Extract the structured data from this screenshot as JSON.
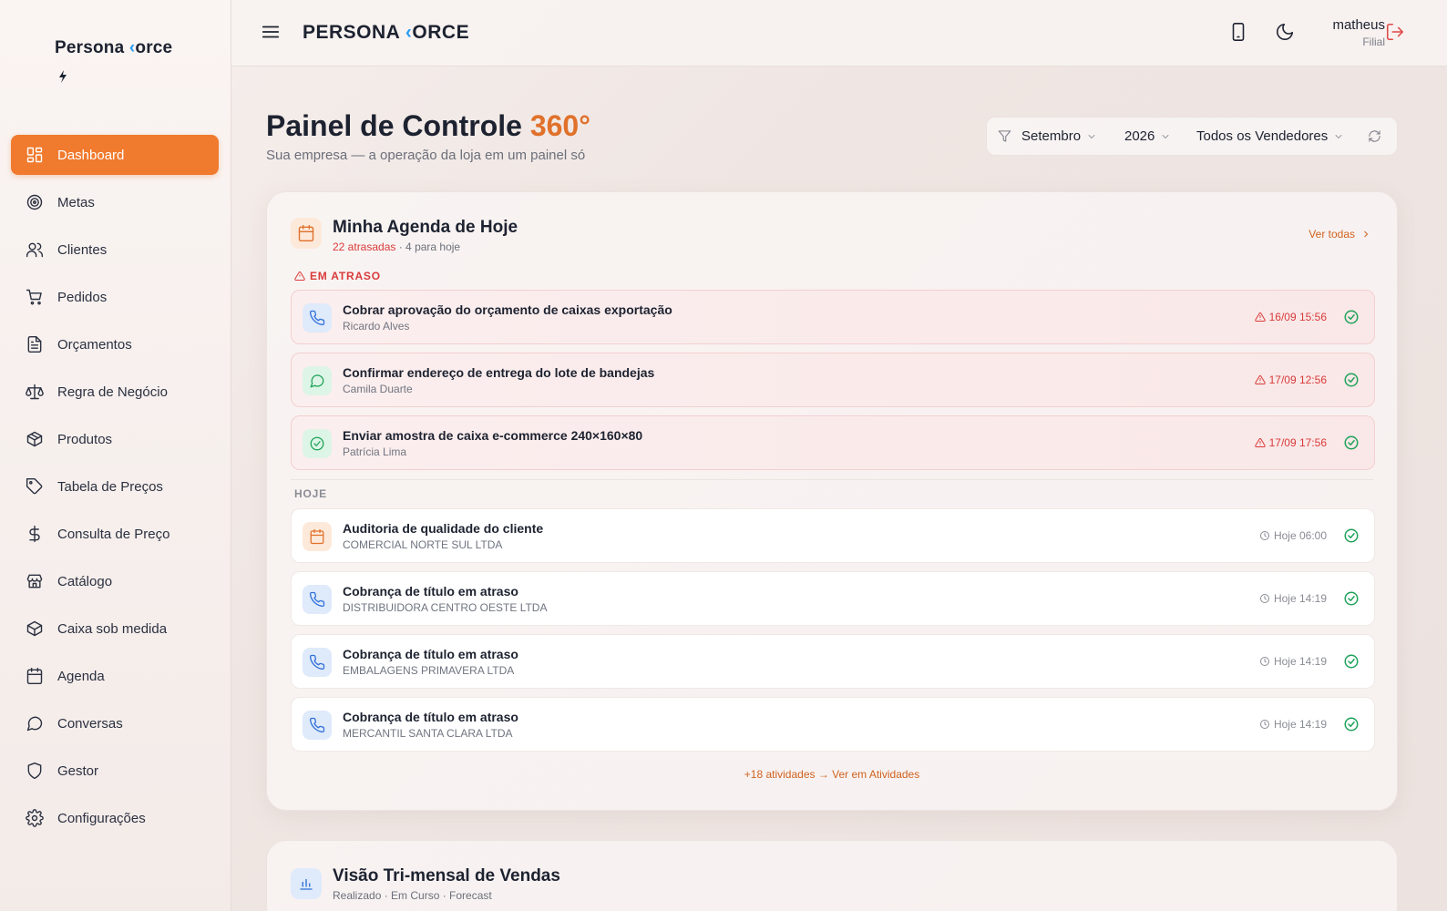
{
  "sidebar": {
    "brand_left": "Persona ",
    "brand_bolt": "⚡",
    "brand_right": "orce",
    "brand_sub": "⚡",
    "items": [
      {
        "label": "Dashboard",
        "icon": "dashboard-icon",
        "active": true
      },
      {
        "label": "Metas",
        "icon": "target-icon"
      },
      {
        "label": "Clientes",
        "icon": "users-icon"
      },
      {
        "label": "Pedidos",
        "icon": "cart-icon"
      },
      {
        "label": "Orçamentos",
        "icon": "document-icon"
      },
      {
        "label": "Regra de Negócio",
        "icon": "scale-icon"
      },
      {
        "label": "Produtos",
        "icon": "package-icon"
      },
      {
        "label": "Tabela de Preços",
        "icon": "tag-icon"
      },
      {
        "label": "Consulta de Preço",
        "icon": "dollar-icon"
      },
      {
        "label": "Catálogo",
        "icon": "store-icon"
      },
      {
        "label": "Caixa sob medida",
        "icon": "box-icon"
      },
      {
        "label": "Agenda",
        "icon": "calendar-icon"
      },
      {
        "label": "Conversas",
        "icon": "chat-icon"
      },
      {
        "label": "Gestor",
        "icon": "shield-icon"
      },
      {
        "label": "Configurações",
        "icon": "gear-icon"
      }
    ]
  },
  "topbar": {
    "brand_left": "PERSONA ",
    "brand_bolt": "⚡",
    "brand_right": "ORCE",
    "user_name": "matheus",
    "user_role": "Filial"
  },
  "header": {
    "title": "Painel de Controle ",
    "title_accent": "360°",
    "subtitle": "Sua empresa — a operação da loja em um painel só"
  },
  "filters": {
    "month": "Setembro",
    "year": "2026",
    "seller": "Todos os Vendedores"
  },
  "agenda": {
    "title": "Minha Agenda de Hoje",
    "overdue_count": "22 atrasadas",
    "today_count": " · 4 para hoje",
    "see_all": "Ver todas",
    "late_label": "EM ATRASO",
    "today_label": "HOJE",
    "late_tasks": [
      {
        "title": "Cobrar aprovação do orçamento de caixas exportação",
        "person": "Ricardo Alves",
        "time": "16/09 15:56",
        "icon": "phone-icon"
      },
      {
        "title": "Confirmar endereço de entrega do lote de bandejas",
        "person": "Camila Duarte",
        "time": "17/09 12:56",
        "icon": "chat-icon"
      },
      {
        "title": "Enviar amostra de caixa e-commerce 240×160×80",
        "person": "Patrícia Lima",
        "time": "17/09 17:56",
        "icon": "check-circle-icon"
      }
    ],
    "today_tasks": [
      {
        "title": "Auditoria de qualidade do cliente",
        "person": "COMERCIAL NORTE SUL LTDA",
        "time": "Hoje 06:00",
        "icon": "calendar-icon"
      },
      {
        "title": "Cobrança de título em atraso",
        "person": "DISTRIBUIDORA CENTRO OESTE LTDA",
        "time": "Hoje 14:19",
        "icon": "phone-icon"
      },
      {
        "title": "Cobrança de título em atraso",
        "person": "EMBALAGENS PRIMAVERA LTDA",
        "time": "Hoje 14:19",
        "icon": "phone-icon"
      },
      {
        "title": "Cobrança de título em atraso",
        "person": "MERCANTIL SANTA CLARA LTDA",
        "time": "Hoje 14:19",
        "icon": "phone-icon"
      }
    ],
    "more_link": "+18 atividades → Ver em Atividades"
  },
  "sales": {
    "title": "Visão Tri-mensal de Vendas",
    "subtitle": "Realizado · Em Curso · Forecast"
  },
  "colors": {
    "accent": "#f07a2e",
    "overdue": "#d93a3a",
    "success": "#1fa25a"
  }
}
